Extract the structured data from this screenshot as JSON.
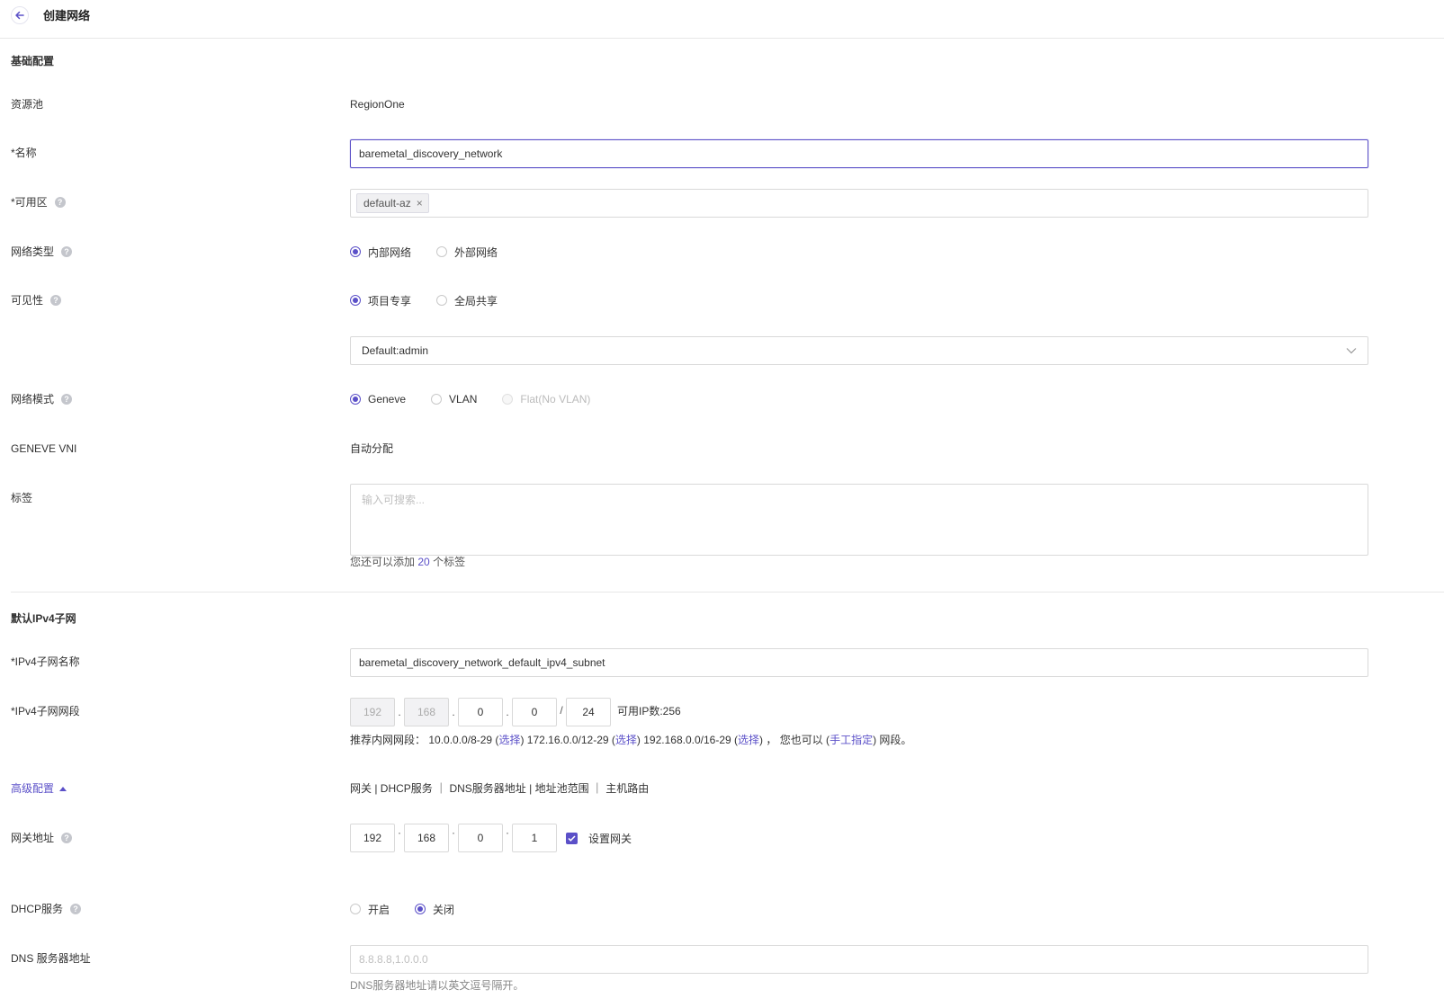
{
  "header": {
    "title": "创建网络"
  },
  "basic": {
    "section_title": "基础配置",
    "resource_pool": {
      "label": "资源池",
      "value": "RegionOne"
    },
    "name": {
      "label": "*名称",
      "value": "baremetal_discovery_network"
    },
    "availability_zone": {
      "label": "*可用区",
      "tag": "default-az"
    },
    "network_type": {
      "label": "网络类型",
      "options": [
        "内部网络",
        "外部网络"
      ],
      "selected": "内部网络"
    },
    "visibility": {
      "label": "可见性",
      "options": [
        "项目专享",
        "全局共享"
      ],
      "selected": "项目专享"
    },
    "project_select": {
      "value": "Default:admin"
    },
    "network_mode": {
      "label": "网络模式",
      "options": [
        "Geneve",
        "VLAN",
        "Flat(No VLAN)"
      ],
      "selected": "Geneve",
      "disabled": [
        "Flat(No VLAN)"
      ]
    },
    "geneve_vni": {
      "label": "GENEVE VNI",
      "value": "自动分配"
    },
    "tags": {
      "label": "标签",
      "placeholder": "输入可搜索...",
      "hint_prefix": "您还可以添加",
      "hint_count": "20",
      "hint_suffix": "个标签"
    }
  },
  "subnet": {
    "section_title": "默认IPv4子网",
    "name": {
      "label": "*IPv4子网名称",
      "value": "baremetal_discovery_network_default_ipv4_subnet"
    },
    "cidr": {
      "label": "*IPv4子网网段",
      "octets": [
        "192",
        "168",
        "0",
        "0"
      ],
      "mask": "24",
      "available": "可用IP数:256"
    },
    "recommend": {
      "prefix": "推荐内网网段：",
      "r1": "10.0.0.0/8-29",
      "r2": "172.16.0.0/12-29",
      "r3": "192.168.0.0/16-29",
      "select": "选择",
      "also": "， 您也可以",
      "manual": "手工指定",
      "suffix": "网段。"
    },
    "advanced": {
      "label": "高级配置",
      "summary": "网关 | DHCP服务 ｜ DNS服务器地址 | 地址池范围 ｜ 主机路由"
    },
    "gateway": {
      "label": "网关地址",
      "octets": [
        "192",
        "168",
        "0",
        "1"
      ],
      "checkbox_label": "设置网关"
    },
    "dhcp": {
      "label": "DHCP服务",
      "options": [
        "开启",
        "关闭"
      ],
      "selected": "关闭"
    },
    "dns": {
      "label": "DNS 服务器地址",
      "placeholder": "8.8.8.8,1.0.0.0",
      "hint": "DNS服务器地址请以英文逗号隔开。"
    }
  },
  "colors": {
    "accent": "#5b50c8",
    "border": "#d9d9d9"
  }
}
